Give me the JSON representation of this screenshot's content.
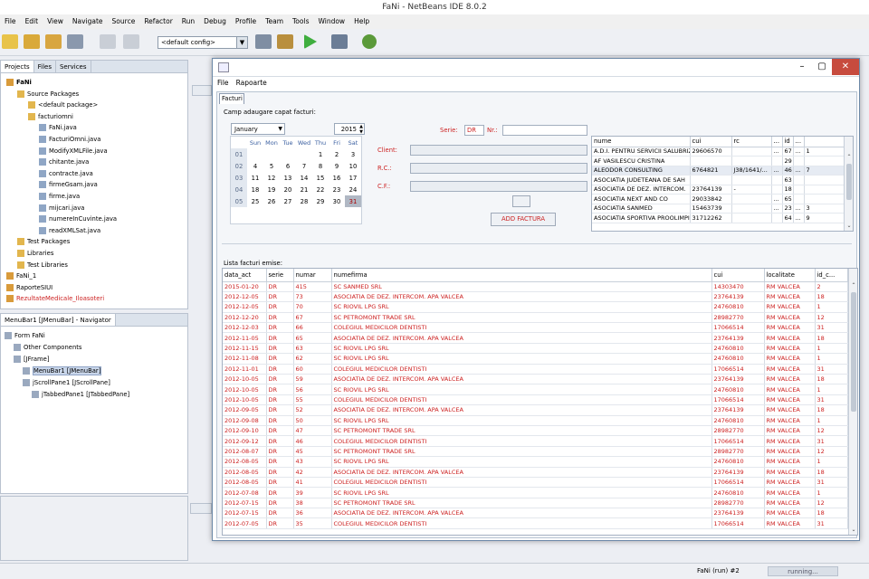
{
  "ide": {
    "title": "FaNi - NetBeans IDE 8.0.2",
    "menu": [
      "File",
      "Edit",
      "View",
      "Navigate",
      "Source",
      "Refactor",
      "Run",
      "Debug",
      "Profile",
      "Team",
      "Tools",
      "Window",
      "Help"
    ],
    "config": "<default config>"
  },
  "projects": {
    "tabs": [
      "Projects",
      "Files",
      "Services"
    ],
    "tree": [
      {
        "label": "FaNi",
        "level": 0,
        "bold": true
      },
      {
        "label": "Source Packages",
        "level": 1
      },
      {
        "label": "<default package>",
        "level": 2
      },
      {
        "label": "facturiomni",
        "level": 2
      },
      {
        "label": "FaNi.java",
        "level": 3
      },
      {
        "label": "FacturiOmni.java",
        "level": 3
      },
      {
        "label": "ModifyXMLFile.java",
        "level": 3
      },
      {
        "label": "chitante.java",
        "level": 3
      },
      {
        "label": "contracte.java",
        "level": 3
      },
      {
        "label": "firmeGsam.java",
        "level": 3
      },
      {
        "label": "firme.java",
        "level": 3
      },
      {
        "label": "mijcari.java",
        "level": 3
      },
      {
        "label": "numereInCuvinte.java",
        "level": 3
      },
      {
        "label": "readXMLSat.java",
        "level": 3
      },
      {
        "label": "Test Packages",
        "level": 1
      },
      {
        "label": "Libraries",
        "level": 1
      },
      {
        "label": "Test Libraries",
        "level": 1
      },
      {
        "label": "FaNi_1",
        "level": 0
      },
      {
        "label": "RaporteSIUI",
        "level": 0
      },
      {
        "label": "RezultateMedicale_Iloasoteri",
        "level": 0,
        "red": true
      }
    ]
  },
  "navigator": {
    "title": "MenuBar1 [JMenuBar] - Navigator",
    "tree": [
      {
        "label": "Form FaNi",
        "level": 0
      },
      {
        "label": "Other Components",
        "level": 1
      },
      {
        "label": "[JFrame]",
        "level": 1
      },
      {
        "label": "MenuBar1 [JMenuBar]",
        "level": 2,
        "selected": true
      },
      {
        "label": "jScrollPane1 [JScrollPane]",
        "level": 2
      },
      {
        "label": "jTabbedPane1 [JTabbedPane]",
        "level": 3
      }
    ]
  },
  "status": {
    "process": "FaNi (run) #2",
    "state": "running..."
  },
  "app": {
    "menu": [
      "File",
      "Rapoarte"
    ],
    "tab": "Facturi",
    "group_title": "Camp adaugare capat facturi:",
    "month": "January",
    "year": "2015",
    "cal_headers": [
      "Sun",
      "Mon",
      "Tue",
      "Wed",
      "Thu",
      "Fri",
      "Sat"
    ],
    "cal_rows": [
      {
        "wk": "01",
        "days": [
          "",
          "",
          "",
          "",
          "1",
          "2",
          "3"
        ]
      },
      {
        "wk": "02",
        "days": [
          "4",
          "5",
          "6",
          "7",
          "8",
          "9",
          "10"
        ]
      },
      {
        "wk": "03",
        "days": [
          "11",
          "12",
          "13",
          "14",
          "15",
          "16",
          "17"
        ]
      },
      {
        "wk": "04",
        "days": [
          "18",
          "19",
          "20",
          "21",
          "22",
          "23",
          "24"
        ]
      },
      {
        "wk": "05",
        "days": [
          "25",
          "26",
          "27",
          "28",
          "29",
          "30",
          "31"
        ]
      }
    ],
    "serie_label": "Serie:",
    "serie_value": "DR",
    "nr_label": "Nr.:",
    "client_label": "Client:",
    "rc_label": "R.C.:",
    "cf_label": "C.F.:",
    "add_button": "ADD FACTURA",
    "client_columns": [
      "nume",
      "cui",
      "rc",
      "...",
      "id",
      "..."
    ],
    "clients": [
      [
        "A.D.I. PENTRU SERVICII SALUBRIZ...",
        "29606570",
        "",
        "...",
        "67",
        "...",
        "1"
      ],
      [
        "AF VASILESCU CRISTINA",
        "",
        "",
        "",
        "29",
        "",
        ""
      ],
      [
        "ALEODOR CONSULTING",
        "6764821",
        "J38/1641/...",
        "...",
        "46",
        "...",
        "7"
      ],
      [
        "ASOCIATIA JUDETEANA DE SAH",
        "",
        "",
        "",
        "63",
        "",
        ""
      ],
      [
        "ASOCIATIA DE DEZ. INTERCOM.",
        "23764139",
        "-",
        "",
        "18",
        "",
        ""
      ],
      [
        "ASOCIATIA NEXT AND CO",
        "29033842",
        "",
        "...",
        "65",
        "",
        ""
      ],
      [
        "ASOCIATIA SANMED",
        "15463739",
        "",
        "...",
        "23",
        "...",
        "3"
      ],
      [
        "ASOCIATIA SPORTIVA PROOLIMPIC",
        "31712262",
        "",
        "",
        "64",
        "...",
        "9"
      ]
    ],
    "lista_label": "Lista facturi emise:",
    "invoice_columns": [
      "data_act",
      "serie",
      "numar",
      "numefirma",
      "cui",
      "localitate",
      "id_c..."
    ],
    "invoices": [
      [
        "2015-01-20",
        "DR",
        "415",
        "SC SANMED SRL",
        "14303470",
        "RM VALCEA",
        "2"
      ],
      [
        "2012-12-05",
        "DR",
        "73",
        "ASOCIATIA DE DEZ. INTERCOM. APA VALCEA",
        "23764139",
        "RM VALCEA",
        "18"
      ],
      [
        "2012-12-05",
        "DR",
        "70",
        "SC RIOVIL LPG SRL",
        "24760810",
        "RM VALCEA",
        "1"
      ],
      [
        "2012-12-20",
        "DR",
        "67",
        "SC PETROMONT TRADE SRL",
        "28982770",
        "RM VALCEA",
        "12"
      ],
      [
        "2012-12-03",
        "DR",
        "66",
        "COLEGIUL MEDICILOR DENTISTI",
        "17066514",
        "RM VALCEA",
        "31"
      ],
      [
        "2012-11-05",
        "DR",
        "65",
        "ASOCIATIA DE DEZ. INTERCOM. APA VALCEA",
        "23764139",
        "RM VALCEA",
        "18"
      ],
      [
        "2012-11-15",
        "DR",
        "63",
        "SC RIOVIL LPG SRL",
        "24760810",
        "RM VALCEA",
        "1"
      ],
      [
        "2012-11-08",
        "DR",
        "62",
        "SC RIOVIL LPG SRL",
        "24760810",
        "RM VALCEA",
        "1"
      ],
      [
        "2012-11-01",
        "DR",
        "60",
        "COLEGIUL MEDICILOR DENTISTI",
        "17066514",
        "RM VALCEA",
        "31"
      ],
      [
        "2012-10-05",
        "DR",
        "59",
        "ASOCIATIA DE DEZ. INTERCOM. APA VALCEA",
        "23764139",
        "RM VALCEA",
        "18"
      ],
      [
        "2012-10-05",
        "DR",
        "56",
        "SC RIOVIL LPG SRL",
        "24760810",
        "RM VALCEA",
        "1"
      ],
      [
        "2012-10-05",
        "DR",
        "55",
        "COLEGIUL MEDICILOR DENTISTI",
        "17066514",
        "RM VALCEA",
        "31"
      ],
      [
        "2012-09-05",
        "DR",
        "52",
        "ASOCIATIA DE DEZ. INTERCOM. APA VALCEA",
        "23764139",
        "RM VALCEA",
        "18"
      ],
      [
        "2012-09-08",
        "DR",
        "50",
        "SC RIOVIL LPG SRL",
        "24760810",
        "RM VALCEA",
        "1"
      ],
      [
        "2012-09-10",
        "DR",
        "47",
        "SC PETROMONT TRADE SRL",
        "28982770",
        "RM VALCEA",
        "12"
      ],
      [
        "2012-09-12",
        "DR",
        "46",
        "COLEGIUL MEDICILOR DENTISTI",
        "17066514",
        "RM VALCEA",
        "31"
      ],
      [
        "2012-08-07",
        "DR",
        "45",
        "SC PETROMONT TRADE SRL",
        "28982770",
        "RM VALCEA",
        "12"
      ],
      [
        "2012-08-05",
        "DR",
        "43",
        "SC RIOVIL LPG SRL",
        "24760810",
        "RM VALCEA",
        "1"
      ],
      [
        "2012-08-05",
        "DR",
        "42",
        "ASOCIATIA DE DEZ. INTERCOM. APA VALCEA",
        "23764139",
        "RM VALCEA",
        "18"
      ],
      [
        "2012-08-05",
        "DR",
        "41",
        "COLEGIUL MEDICILOR DENTISTI",
        "17066514",
        "RM VALCEA",
        "31"
      ],
      [
        "2012-07-08",
        "DR",
        "39",
        "SC RIOVIL LPG SRL",
        "24760810",
        "RM VALCEA",
        "1"
      ],
      [
        "2012-07-15",
        "DR",
        "38",
        "SC PETROMONT TRADE SRL",
        "28982770",
        "RM VALCEA",
        "12"
      ],
      [
        "2012-07-15",
        "DR",
        "36",
        "ASOCIATIA DE DEZ. INTERCOM. APA VALCEA",
        "23764139",
        "RM VALCEA",
        "18"
      ],
      [
        "2012-07-05",
        "DR",
        "35",
        "COLEGIUL MEDICILOR DENTISTI",
        "17066514",
        "RM VALCEA",
        "31"
      ]
    ]
  },
  "colors": {
    "accent": "#cc2222",
    "close": "#c74b3e",
    "selected_day": "#b0b8c4"
  }
}
